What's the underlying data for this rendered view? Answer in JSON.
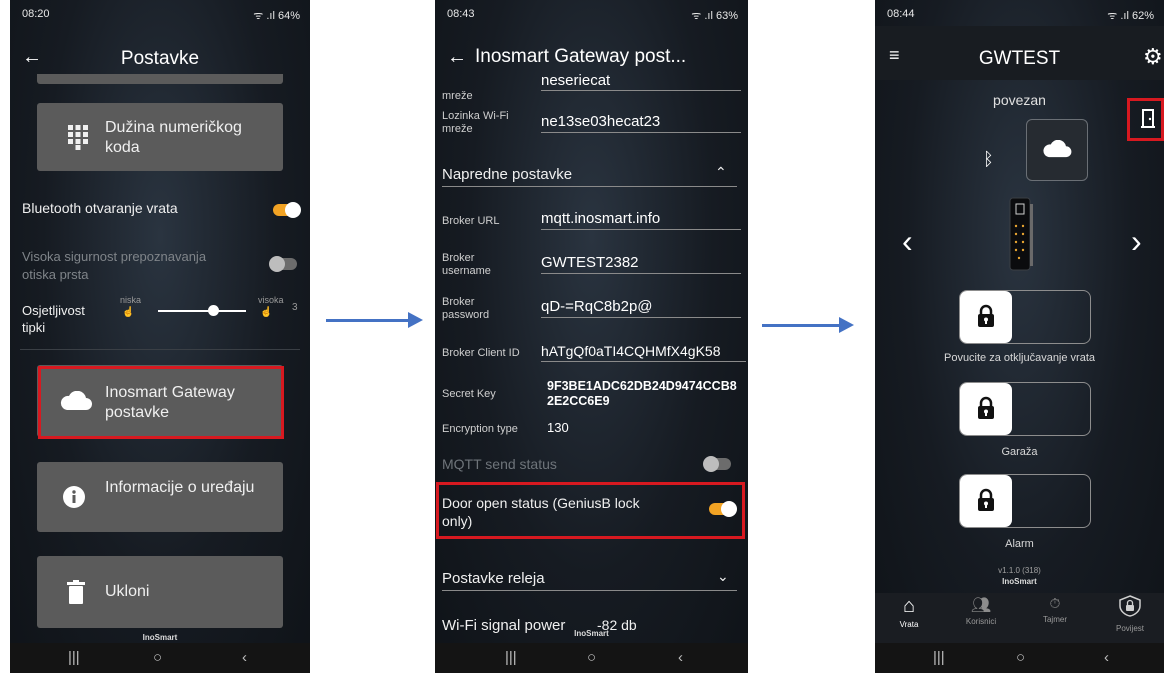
{
  "phone1": {
    "status": {
      "time": "08:20",
      "right": "ᯤ .ıl 64%"
    },
    "header": {
      "back": "←",
      "title": "Postavke"
    },
    "tiles": {
      "numeric": "Dužina numeričkog koda",
      "gateway": "Inosmart Gateway postavke",
      "info": "Informacije o uređaju",
      "remove": "Ukloni"
    },
    "settings": {
      "bluetooth_label": "Bluetooth otvaranje vrata",
      "fingerprint_label": "Visoka sigurnost prepoznavanja otiska prsta",
      "sensitivity_label": "Osjetljivost tipki",
      "low_label": "niska",
      "high_label": "visoka",
      "level_value": "3"
    },
    "brand": "InoSmart",
    "nav": {
      "recent": "|||",
      "home": "○",
      "back": "‹"
    }
  },
  "phone2": {
    "status": {
      "time": "08:43",
      "right": "ᯤ .ıl 63%"
    },
    "header": {
      "back": "←",
      "title": "Inosmart Gateway post..."
    },
    "wifi": {
      "network_label": "mreže",
      "network_value": "neseriecat",
      "password_label": "Lozinka Wi-Fi mreže",
      "password_value": "ne13se03hecat23"
    },
    "advanced": {
      "section": "Napredne postavke",
      "broker_url_label": "Broker URL",
      "broker_url": "mqtt.inosmart.info",
      "broker_user_label": "Broker username",
      "broker_user": "GWTEST2382",
      "broker_pass_label": "Broker password",
      "broker_pass": "qD-=RqC8b2p@",
      "client_id_label": "Broker Client ID",
      "client_id": "hATgQf0aTI4CQHMfX4gK58",
      "secret_key_label": "Secret Key",
      "secret_key": "9F3BE1ADC62DB24D9474CCB82E2CC6E9",
      "encryption_label": "Encryption type",
      "encryption_value": "130",
      "mqtt_label": "MQTT send status",
      "door_status_label": "Door open status (GeniusB lock only)"
    },
    "relay_section": "Postavke releja",
    "wifi_power_label": "Wi-Fi signal power",
    "wifi_power_value": "-82 db",
    "brand": "InoSmart",
    "nav": {
      "recent": "|||",
      "home": "○",
      "back": "‹"
    }
  },
  "phone3": {
    "status": {
      "time": "08:44",
      "right": "ᯤ .ıl 62%"
    },
    "header": {
      "title": "GWTEST"
    },
    "connection_status": "povezan",
    "locks": [
      {
        "caption": "Povucite za otključavanje vrata"
      },
      {
        "caption": "Garaža"
      },
      {
        "caption": "Alarm"
      }
    ],
    "version": "v1.1.0 (318)",
    "brand": "InoSmart",
    "tabs": [
      "Vrata",
      "Korisnici",
      "Tajmer",
      "Povijest"
    ],
    "nav": {
      "recent": "|||",
      "home": "○",
      "back": "‹"
    }
  },
  "colors": {
    "accent": "#f2a324",
    "highlight": "#d71920",
    "arrow": "#4472c4"
  }
}
